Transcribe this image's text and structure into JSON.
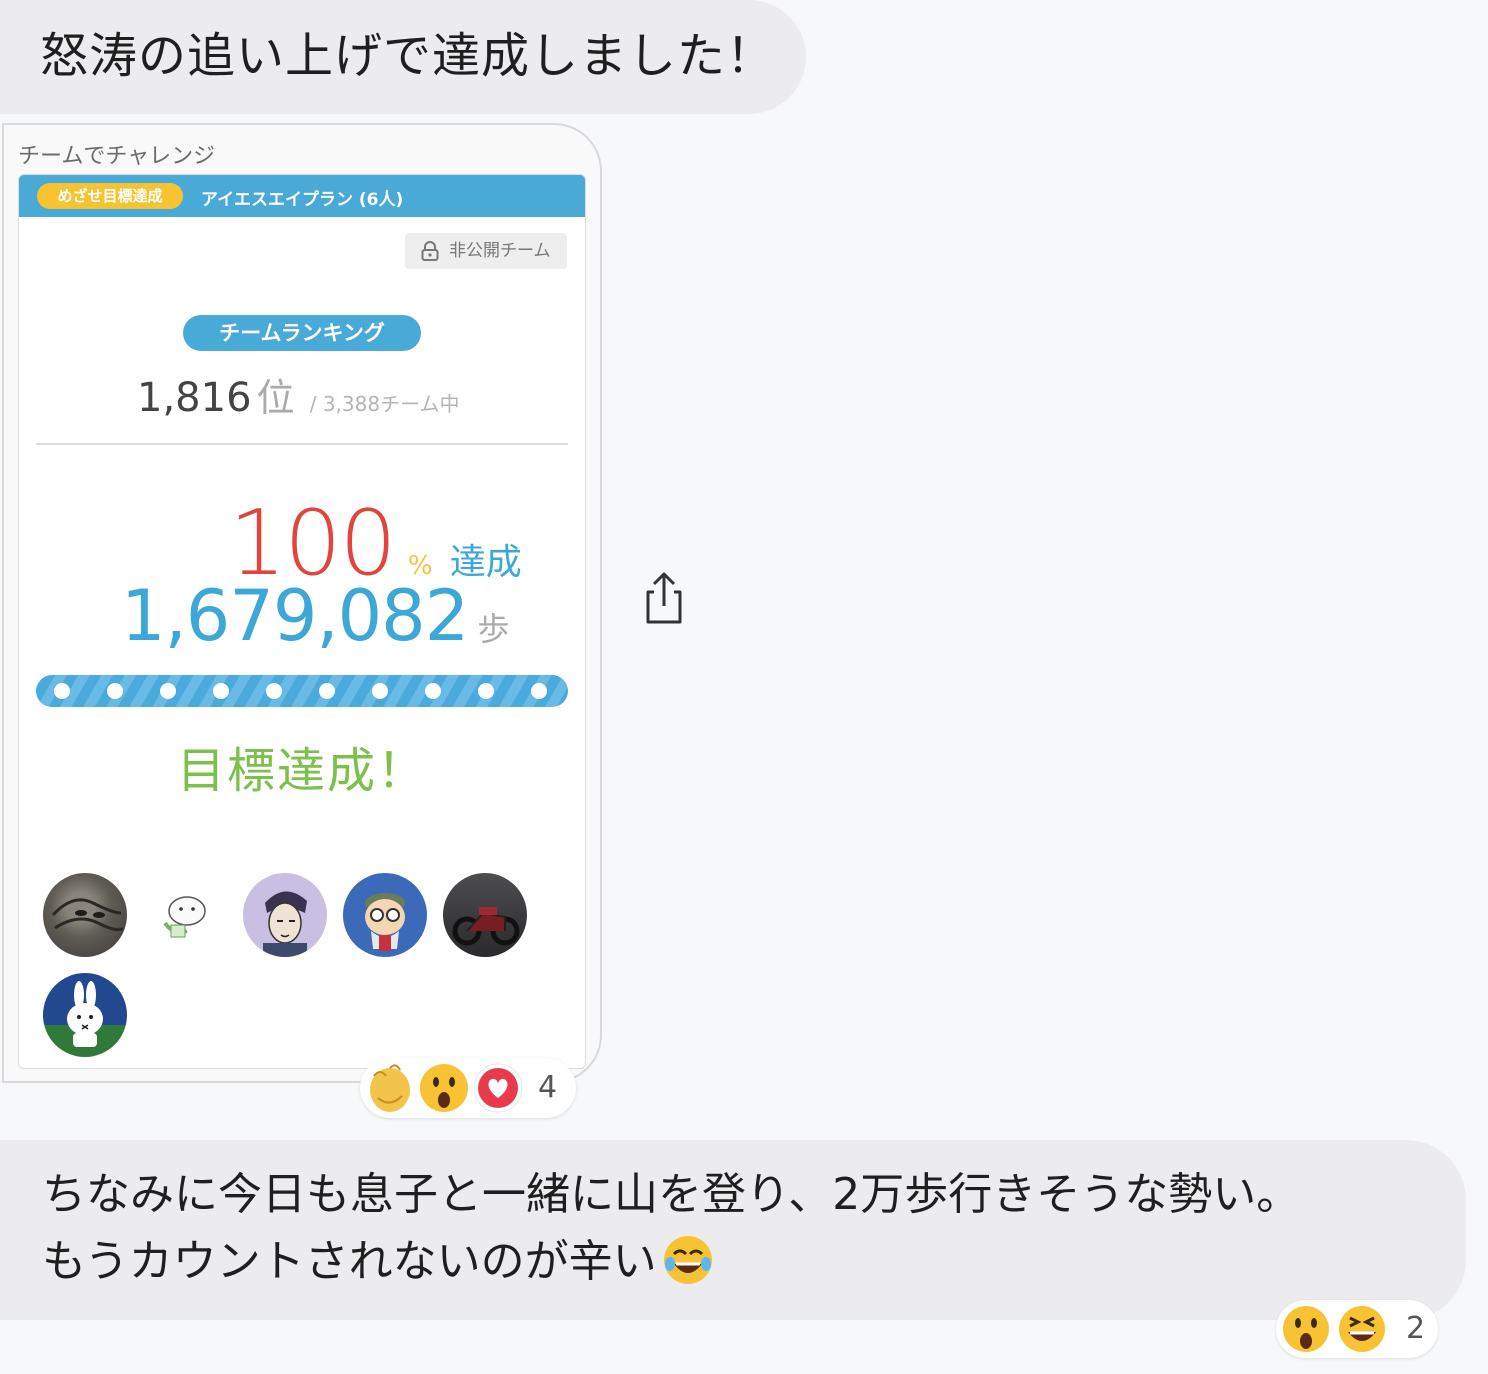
{
  "messages": {
    "m1": "怒涛の追い上げで達成しました！",
    "m3_line1": "ちなみに今日も息子と一緒に山を登り、2万歩行きそうな勢い。",
    "m3_line2": "もうカウントされないのが辛い"
  },
  "card": {
    "source_label": "チームでチャレンジ",
    "goal_pill": "めざせ目標達成",
    "team_name": "アイエスエイプラン (6人)",
    "private_label": "非公開チーム",
    "ranking_label": "チームランキング",
    "rank": "1,816",
    "rank_unit": "位",
    "rank_total": "/ 3,388チーム中",
    "percent": "100",
    "percent_sign": "%",
    "percent_label": "達成",
    "steps": "1,679,082",
    "steps_unit": "歩",
    "achieved": "目標達成！",
    "progress": 1.0
  },
  "reactions": {
    "first": {
      "emojis": [
        "clap-emoji",
        "surprised-emoji",
        "heart-emoji"
      ],
      "count": "4"
    },
    "second": {
      "emojis": [
        "surprised-emoji",
        "laughing-emoji"
      ],
      "count": "2"
    }
  },
  "icons": {
    "share": "share-icon",
    "lock": "lock-icon"
  },
  "colors": {
    "accent_blue": "#49aad8",
    "percent_red": "#e0453e",
    "goal_yellow": "#f7c331",
    "achieved_green": "#7dc04b"
  }
}
